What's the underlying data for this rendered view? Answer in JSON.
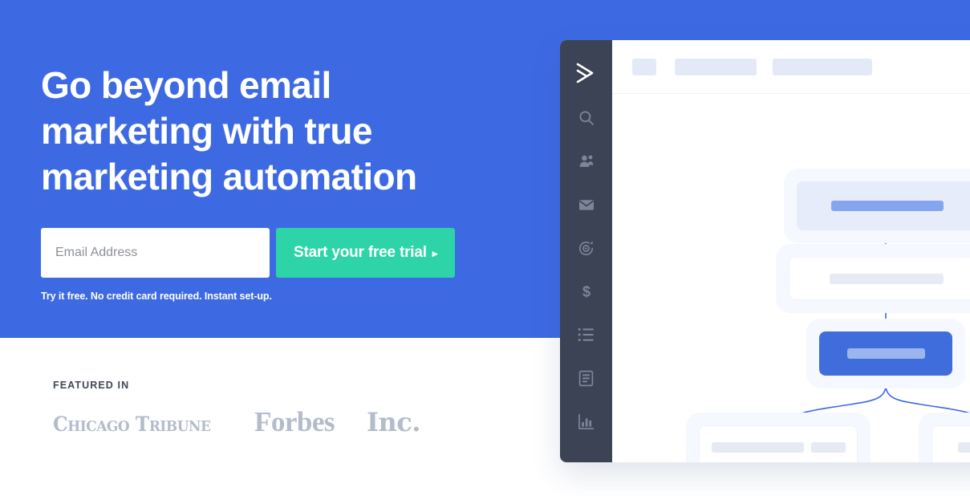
{
  "hero": {
    "headline": "Go beyond email\nmarketing with true\nmarketing automation",
    "email_placeholder": "Email Address",
    "email_value": "",
    "cta_label": "Start your free trial",
    "cta_arrow": "▸",
    "disclaimer": "Try it free. No credit card required. Instant set-up.",
    "background_color": "#3d6ae3",
    "cta_color": "#2dd4a7"
  },
  "featured": {
    "label": "FEATURED IN",
    "logos": [
      {
        "name": "chicago-tribune",
        "text": "Chicago Tribune"
      },
      {
        "name": "forbes",
        "text": "Forbes"
      },
      {
        "name": "inc",
        "text": "Inc."
      }
    ],
    "logo_color": "#b3bbcc"
  },
  "app": {
    "sidebar": {
      "background_color": "#3b4354",
      "logo_icon": "activecampaign-logo-icon",
      "items": [
        {
          "icon": "search-icon",
          "label": "Search"
        },
        {
          "icon": "contacts-icon",
          "label": "Contacts"
        },
        {
          "icon": "mail-icon",
          "label": "Campaigns"
        },
        {
          "icon": "automation-icon",
          "label": "Automations"
        },
        {
          "icon": "deals-dollar-icon",
          "label": "Deals"
        },
        {
          "icon": "list-icon",
          "label": "Lists"
        },
        {
          "icon": "pages-icon",
          "label": "Pages"
        },
        {
          "icon": "bar-chart-icon",
          "label": "Reports"
        }
      ]
    },
    "topbar": {
      "placeholders": [
        "skeleton-square",
        "skeleton-medium",
        "skeleton-large"
      ],
      "button_color": "#3d6ae3"
    },
    "flow": {
      "nodes": [
        {
          "name": "trigger-node",
          "type": "trigger",
          "color": "#e6ecf9",
          "bars": 1
        },
        {
          "name": "step-node",
          "type": "step",
          "color": "#ffffff",
          "bars": 1
        },
        {
          "name": "action-node",
          "type": "action",
          "color": "#3f6ddb",
          "bars": 1
        },
        {
          "name": "branch-node-left",
          "type": "branch",
          "color": "#ffffff",
          "bars": 2
        },
        {
          "name": "branch-node-right",
          "type": "branch",
          "color": "#ffffff",
          "bars": 1
        }
      ],
      "connector_color": "#3d6ae3"
    }
  }
}
